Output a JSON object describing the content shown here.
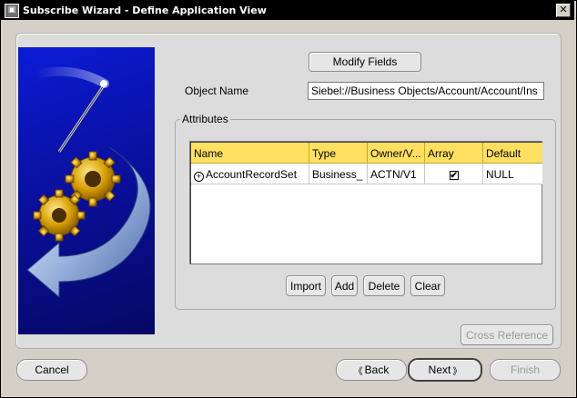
{
  "window": {
    "title": "Subscribe Wizard  - Define Application View",
    "close_glyph": "✕"
  },
  "form": {
    "modify_fields_label": "Modify Fields",
    "object_name_label": "Object Name",
    "object_name_value": "Siebel://Business Objects/Account/Account/Ins"
  },
  "attributes": {
    "group_label": "Attributes",
    "columns": [
      "Name",
      "Type",
      "Owner/V...",
      "Array",
      "Default"
    ],
    "rows": [
      {
        "expand_glyph": "+",
        "name": "AccountRecordSet",
        "type": "Business_",
        "owner": "ACTN/V1",
        "array_checked": true,
        "check_glyph": "✔",
        "default": "NULL"
      }
    ],
    "buttons": {
      "import": "Import",
      "add": "Add",
      "delete": "Delete",
      "clear": "Clear"
    }
  },
  "cross_reference_label": "Cross Reference",
  "footer": {
    "cancel": "Cancel",
    "back": "Back",
    "next": "Next",
    "finish": "Finish",
    "back_glyph": "《",
    "next_glyph": "》"
  },
  "colors": {
    "header_fill": "#ffe060",
    "image_blue": "#0a10a0",
    "dialog_bg": "#d4d0c8"
  },
  "icons": {
    "decorative": "wizard-gears-arrow-illustration"
  }
}
